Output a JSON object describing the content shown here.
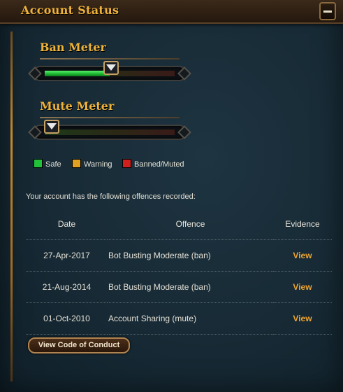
{
  "window": {
    "title": "Account Status",
    "collapse_icon": "minus-icon"
  },
  "ban_meter": {
    "title": "Ban Meter",
    "level": 0.5
  },
  "mute_meter": {
    "title": "Mute Meter",
    "level": 0.0
  },
  "legend": [
    {
      "label": "Safe",
      "color": "#21c23a"
    },
    {
      "label": "Warning",
      "color": "#e0a020"
    },
    {
      "label": "Banned/Muted",
      "color": "#d0201e"
    }
  ],
  "offences": {
    "intro": "Your account has the following offences recorded:",
    "headers": {
      "date": "Date",
      "offence": "Offence",
      "evidence": "Evidence"
    },
    "rows": [
      {
        "date": "27-Apr-2017",
        "offence": "Bot Busting Moderate (ban)",
        "evidence": "View"
      },
      {
        "date": "21-Aug-2014",
        "offence": "Bot Busting Moderate (ban)",
        "evidence": "View"
      },
      {
        "date": "01-Oct-2010",
        "offence": "Account Sharing (mute)",
        "evidence": "View"
      }
    ]
  },
  "footer": {
    "code_of_conduct_label": "View Code of Conduct"
  }
}
